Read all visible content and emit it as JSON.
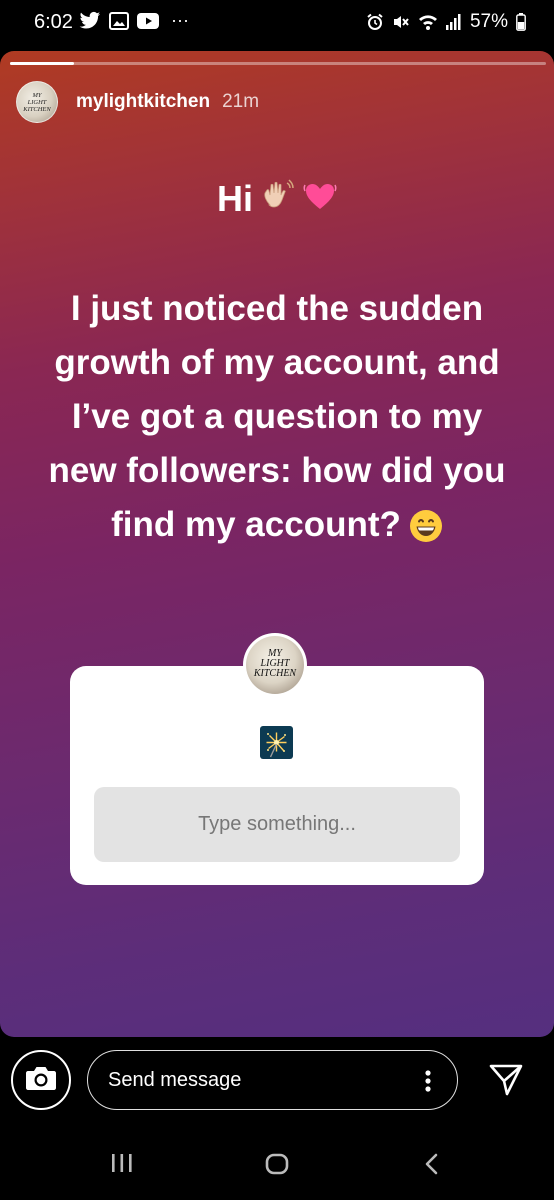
{
  "status_bar": {
    "time": "6:02",
    "left_icons": [
      "twitter-icon",
      "gallery-icon",
      "youtube-icon",
      "more-notifications-icon"
    ],
    "more_notifications_glyph": "···",
    "battery_percent": "57%",
    "right_icons": [
      "alarm-icon",
      "mute-icon",
      "wifi-icon",
      "signal-icon",
      "battery-icon"
    ]
  },
  "story": {
    "progress": 0.12,
    "user": {
      "username": "mylightkitchen",
      "time_ago": "21m",
      "avatar_text": "MY\nLIGHT\nKITCHEN"
    },
    "greeting": "Hi",
    "greeting_emojis": [
      "waving-hand-icon",
      "heart-icon"
    ],
    "message": "I just noticed the sudden growth of my account, and I’ve got a question to my new followers: how did you find my account?",
    "message_emoji": "grinning-face-icon",
    "background_colors": [
      "#b03b22",
      "#8a2753",
      "#552f7f"
    ],
    "question_sticker": {
      "avatar_text": "MY\nLIGHT\nKITCHEN",
      "question_emoji": "sparkler-icon",
      "placeholder": "Type something..."
    }
  },
  "reply_bar": {
    "placeholder": "Send message",
    "icons": [
      "camera-icon",
      "more-vertical-icon",
      "send-icon"
    ]
  },
  "nav_bar": {
    "icons": [
      "recent-apps-icon",
      "home-icon",
      "back-icon"
    ]
  }
}
